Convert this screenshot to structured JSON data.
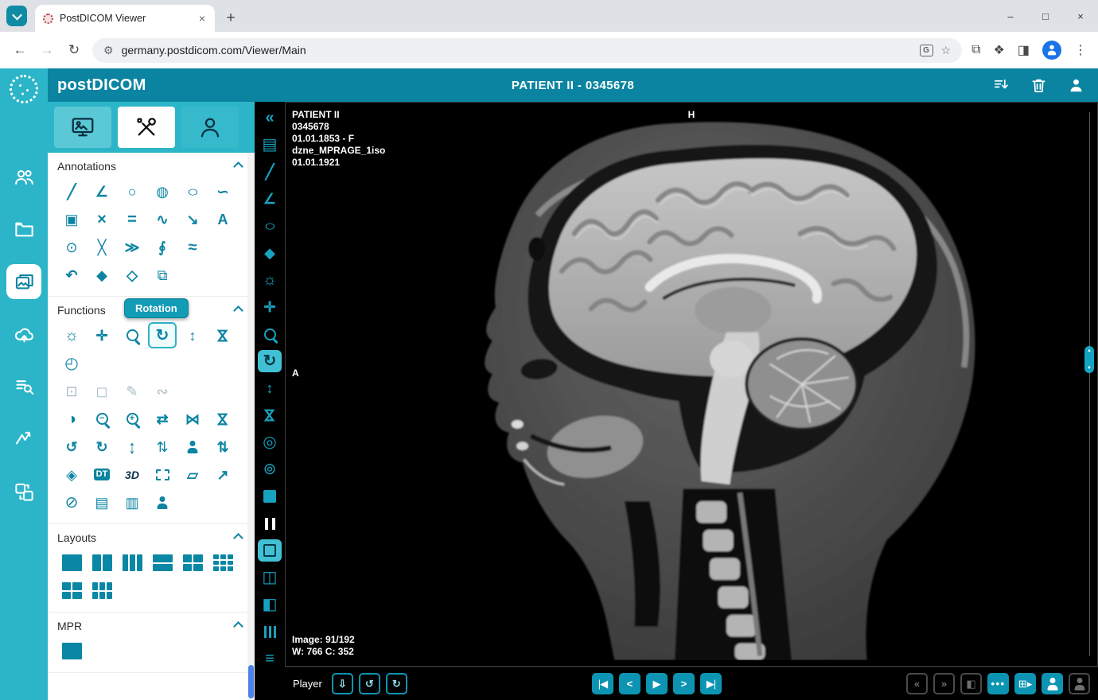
{
  "browser": {
    "tab_title": "PostDICOM Viewer",
    "new_tab_label": "+",
    "url": "germany.postdicom.com/Viewer/Main",
    "close_tab": "×",
    "window_controls": {
      "minimize": "–",
      "maximize": "□",
      "close": "×"
    }
  },
  "labels": {
    "dt": "DT",
    "threed": "3D"
  },
  "app_header": {
    "logo": "postDICOM",
    "title": "PATIENT II - 0345678",
    "icons": [
      "sort-download",
      "delete",
      "profile"
    ]
  },
  "sidebar": {
    "items": [
      {
        "name": "logo",
        "type": "logo"
      },
      {
        "name": "patients"
      },
      {
        "name": "folders"
      },
      {
        "name": "studies",
        "selected": true
      },
      {
        "name": "upload"
      },
      {
        "name": "worklist"
      },
      {
        "name": "share"
      },
      {
        "name": "transfer"
      }
    ]
  },
  "panel": {
    "tabs": [
      {
        "name": "display-settings"
      },
      {
        "name": "tools",
        "active": true
      },
      {
        "name": "patient-info"
      }
    ],
    "tooltip": "Rotation",
    "sections": {
      "annotations": {
        "title": "Annotations",
        "rows": [
          [
            "ruler",
            "angle",
            "circle",
            "shaded-circle",
            "ellipse",
            "freehand"
          ],
          [
            "rect-roi",
            "cross",
            "parallel-lines",
            "polyline",
            "arrow",
            "text"
          ],
          [
            "point",
            "cobb-angle",
            "spline",
            "closed-curve",
            "wave"
          ],
          [
            "undo",
            "eraser",
            "clear-annotations",
            "copy-annotation"
          ]
        ]
      },
      "functions": {
        "title": "Functions",
        "rows": [
          [
            "brightness",
            "pan",
            "magnifier",
            {
              "name": "rotation",
              "selected": true
            },
            "stretch-v",
            "flip-v"
          ],
          [
            "free-rotate"
          ],
          [
            {
              "name": "wl-region",
              "disabled": true
            },
            {
              "name": "magic-select",
              "disabled": true
            },
            {
              "name": "pencil",
              "disabled": true
            },
            {
              "name": "freehand-roi",
              "disabled": true
            }
          ],
          [
            "invert",
            "zoom-out",
            "zoom-in",
            "mirror-h",
            "flip-tri-h",
            "flip-tri-v"
          ],
          [
            "rotate-ccw",
            "rotate-cw",
            "resize-v",
            "collapse-v",
            "person-height",
            "sort-vertical"
          ],
          [
            "tag",
            "dt",
            "threed",
            "dashed-box",
            "skew-box",
            "measure-persp"
          ],
          [
            "image-disable",
            "image-export",
            "image-user",
            "user-question"
          ]
        ]
      },
      "layouts": {
        "title": "Layouts",
        "rows": [
          [
            {
              "name": "layout-1x1",
              "c": 1,
              "r": 1
            },
            {
              "name": "layout-1x2",
              "c": 2,
              "r": 1
            },
            {
              "name": "layout-1x3",
              "c": 3,
              "r": 1
            },
            {
              "name": "layout-2x1",
              "c": 1,
              "r": 2
            },
            {
              "name": "layout-2x2",
              "c": 2,
              "r": 2
            },
            {
              "name": "layout-3x3",
              "c": 3,
              "r": 3
            }
          ],
          [
            {
              "name": "layout-2x2-alt",
              "c": 2,
              "r": 2
            },
            {
              "name": "layout-2x3",
              "c": 3,
              "r": 2
            }
          ]
        ]
      },
      "mpr": {
        "title": "MPR",
        "rows": [
          [
            {
              "name": "mpr-view",
              "c": 1,
              "r": 1
            }
          ]
        ]
      }
    }
  },
  "toolbar": {
    "icons": [
      {
        "name": "collapse-panel"
      },
      {
        "name": "report"
      },
      {
        "name": "ruler"
      },
      {
        "name": "angle"
      },
      {
        "name": "ellipse"
      },
      {
        "name": "eraser"
      },
      {
        "name": "brightness"
      },
      {
        "name": "pan"
      },
      {
        "name": "magnifier"
      },
      {
        "name": "rotation",
        "selected": true
      },
      {
        "name": "stretch-v"
      },
      {
        "name": "flip-v"
      },
      {
        "name": "target-rotate"
      },
      {
        "name": "rotate-dot"
      },
      {
        "name": "solid-square"
      },
      {
        "name": "pause",
        "white": true
      },
      {
        "name": "outline-square",
        "selected": true
      },
      {
        "name": "grid-2"
      },
      {
        "name": "grid-split"
      },
      {
        "name": "stripes-v"
      },
      {
        "name": "stripes-h"
      }
    ]
  },
  "viewer": {
    "overlay_lines": [
      "PATIENT II",
      "0345678",
      "01.01.1853 - F",
      "dzne_MPRAGE_1iso",
      "01.01.1921"
    ],
    "orientation_top": "H",
    "orientation_left": "A",
    "image_counter": "Image: 91/192",
    "window_level": "W: 766 C: 352"
  },
  "player": {
    "label": "Player",
    "left_buttons": [
      {
        "name": "cine-save"
      },
      {
        "name": "cine-loop-ccw"
      },
      {
        "name": "cine-loop-cw"
      }
    ],
    "transport": [
      {
        "name": "first-image"
      },
      {
        "name": "previous-image"
      },
      {
        "name": "play"
      },
      {
        "name": "next-image"
      },
      {
        "name": "last-image"
      }
    ],
    "right_buttons": [
      {
        "name": "fast-rewind",
        "disabled": true
      },
      {
        "name": "fast-forward",
        "disabled": true
      },
      {
        "name": "dock-left",
        "disabled": true
      },
      {
        "name": "more-tools"
      },
      {
        "name": "layout-next"
      },
      {
        "name": "series-user"
      },
      {
        "name": "add-user",
        "disabled": true
      }
    ]
  }
}
